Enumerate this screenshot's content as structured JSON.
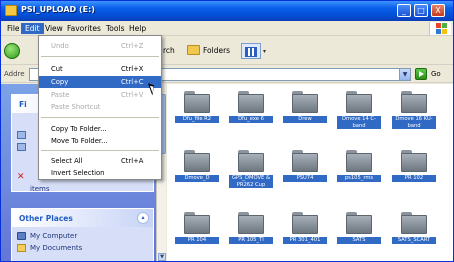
{
  "window": {
    "title": "PSI_UPLOAD (E:)",
    "minimize_symbol": "_",
    "maximize_symbol": "□",
    "close_symbol": "X"
  },
  "menubar": {
    "items": [
      "File",
      "Edit",
      "View",
      "Favorites",
      "Tools",
      "Help"
    ],
    "active": "Edit"
  },
  "toolbar": {
    "search_label": "rch",
    "folders_label": "Folders",
    "views_caret": "▾"
  },
  "address": {
    "label": "Addre",
    "value": "",
    "go_label": "Go"
  },
  "edit_menu": {
    "items": [
      {
        "label": "Undo",
        "shortcut": "Ctrl+Z",
        "state": "disabled"
      },
      {
        "label": "Cut",
        "shortcut": "Ctrl+X",
        "state": "enabled"
      },
      {
        "label": "Copy",
        "shortcut": "Ctrl+C",
        "state": "hover"
      },
      {
        "label": "Paste",
        "shortcut": "Ctrl+V",
        "state": "disabled"
      },
      {
        "label": "Paste Shortcut",
        "shortcut": "",
        "state": "disabled"
      },
      {
        "label": "Copy To Folder...",
        "shortcut": "",
        "state": "enabled"
      },
      {
        "label": "Move To Folder...",
        "shortcut": "",
        "state": "enabled"
      },
      {
        "label": "Select All",
        "shortcut": "Ctrl+A",
        "state": "enabled"
      },
      {
        "label": "Invert Selection",
        "shortcut": "",
        "state": "enabled"
      }
    ]
  },
  "taskpane": {
    "first_box_head": "Fi",
    "partial_item": "items",
    "other_places": {
      "title": "Other Places",
      "chevron": "▴",
      "items": [
        "My Computer",
        "My Documents"
      ]
    }
  },
  "folders": [
    {
      "label": "Dfu_file R2"
    },
    {
      "label": "Dfu_exe 6"
    },
    {
      "label": "Drew"
    },
    {
      "label": "Dmove 14 C-band"
    },
    {
      "label": "Dmove 16 KU-band"
    },
    {
      "label": "Dmove_D"
    },
    {
      "label": "GPS_DMOVE & PR262 Cup"
    },
    {
      "label": "PSU74"
    },
    {
      "label": "ps105_rms"
    },
    {
      "label": "PR 102"
    },
    {
      "label": "PR 104"
    },
    {
      "label": "PR 105_TI"
    },
    {
      "label": "PR 301_401"
    },
    {
      "label": "SATS"
    },
    {
      "label": "SATS_SCART"
    }
  ],
  "colors": {
    "selection": "#316ac5",
    "titlebar": "#0a5fe8",
    "taskpane": "#6375d6",
    "folder": "#8b939c"
  }
}
